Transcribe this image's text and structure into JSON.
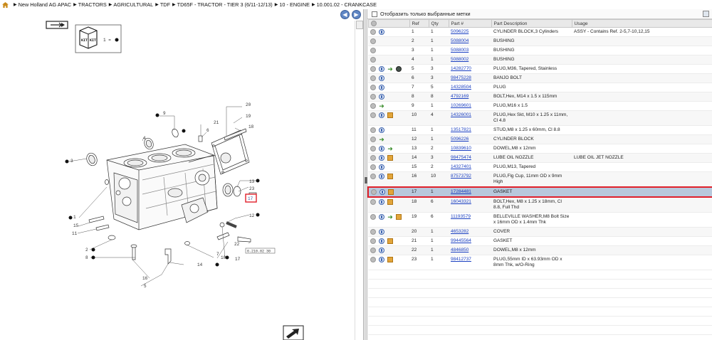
{
  "breadcrumb": {
    "items": [
      "New Holland AG APAC",
      "TRACTORS",
      "AGRICULTURAL",
      "TDF",
      "TD65F - TRACTOR - TIER 3 (6/11-12/13)",
      "10 - ENGINE",
      "10.001.02 - CRANKCASE"
    ]
  },
  "diagram": {
    "kit_marker": "1 =",
    "callouts": {
      "c1": "1",
      "c2": "2",
      "c3": "3",
      "c4": "4",
      "c5": "5",
      "c6": "6",
      "c7": "7",
      "c8": "8",
      "c9": "9",
      "c10": "10",
      "c11": "11",
      "c12": "12",
      "c13": "13",
      "c14": "14",
      "c15": "15",
      "c16": "16",
      "c17": "17",
      "c18": "18",
      "c19": "19",
      "c20": "20",
      "c21": "21",
      "c22": "22",
      "c23": "23"
    },
    "ref_code": "6.210.02  30"
  },
  "filter": {
    "label": "Отобразить только выбранные метки"
  },
  "table": {
    "headers": {
      "ref": "Ref",
      "qty": "Qty",
      "part": "Part #",
      "desc": "Part Description",
      "usage": "Usage"
    },
    "rows": [
      {
        "ref": "1",
        "qty": "1",
        "part": "5096225",
        "desc": "CYLINDER BLOCK,3 Cylinders",
        "usage": "ASSY - Contains Ref. 2-5,7-10,12,15",
        "icons": [
          "c",
          "i"
        ]
      },
      {
        "ref": "2",
        "qty": "1",
        "part": "5088004",
        "desc": "BUSHING",
        "usage": "",
        "icons": [
          "c"
        ]
      },
      {
        "ref": "3",
        "qty": "1",
        "part": "5088003",
        "desc": "BUSHING",
        "usage": "",
        "icons": [
          "c"
        ]
      },
      {
        "ref": "4",
        "qty": "1",
        "part": "5088002",
        "desc": "BUSHING",
        "usage": "",
        "icons": [
          "c"
        ]
      },
      {
        "ref": "5",
        "qty": "3",
        "part": "14282770",
        "desc": "PLUG,M36, Tapered, Stainless",
        "usage": "",
        "icons": [
          "c",
          "i",
          "a",
          "g"
        ]
      },
      {
        "ref": "6",
        "qty": "3",
        "part": "98475228",
        "desc": "BANJO BOLT",
        "usage": "",
        "icons": [
          "c",
          "i"
        ]
      },
      {
        "ref": "7",
        "qty": "5",
        "part": "14328504",
        "desc": "PLUG",
        "usage": "",
        "icons": [
          "c",
          "i"
        ]
      },
      {
        "ref": "8",
        "qty": "8",
        "part": "4792169",
        "desc": "BOLT,Hex, M14 x 1.5 x 115mm",
        "usage": "",
        "icons": [
          "c",
          "i"
        ]
      },
      {
        "ref": "9",
        "qty": "1",
        "part": "10269601",
        "desc": "PLUG,M16 x 1.5",
        "usage": "",
        "icons": [
          "c",
          "a"
        ]
      },
      {
        "ref": "10",
        "qty": "4",
        "part": "14326001",
        "desc": "PLUG,Hex Skt, M10 x 1.25 x 11mm, Cl 4.8",
        "usage": "",
        "icons": [
          "c",
          "i",
          "b"
        ]
      },
      {
        "ref": "11",
        "qty": "1",
        "part": "13517821",
        "desc": "STUD,M8 x 1.25 x 60mm, Cl 8.8",
        "usage": "",
        "icons": [
          "c",
          "i"
        ]
      },
      {
        "ref": "12",
        "qty": "1",
        "part": "5096226",
        "desc": "CYLINDER BLOCK",
        "usage": "",
        "icons": [
          "c",
          "a"
        ]
      },
      {
        "ref": "13",
        "qty": "2",
        "part": "10839610",
        "desc": "DOWEL,M8 x 12mm",
        "usage": "",
        "icons": [
          "c",
          "i",
          "a"
        ]
      },
      {
        "ref": "14",
        "qty": "3",
        "part": "98475474",
        "desc": "LUBE OIL NOZZLE",
        "usage": "LUBE OIL JET NOZZLE",
        "icons": [
          "c",
          "i",
          "b"
        ]
      },
      {
        "ref": "15",
        "qty": "2",
        "part": "14327401",
        "desc": "PLUG,M13, Tapered",
        "usage": "",
        "icons": [
          "c",
          "i"
        ]
      },
      {
        "ref": "16",
        "qty": "10",
        "part": "87573792",
        "desc": "PLUG,Flg Cup, 11mm OD x 9mm High",
        "usage": "",
        "icons": [
          "c",
          "i",
          "b"
        ]
      },
      {
        "ref": "17",
        "qty": "1",
        "part": "17284481",
        "desc": "GASKET",
        "usage": "",
        "icons": [
          "c",
          "i",
          "b"
        ],
        "selected": true
      },
      {
        "ref": "18",
        "qty": "6",
        "part": "16043321",
        "desc": "BOLT,Hex, M8 x 1.25 x 18mm, Cl 8.8, Full Thd",
        "usage": "",
        "icons": [
          "c",
          "i",
          "b"
        ]
      },
      {
        "ref": "19",
        "qty": "6",
        "part": "11193579",
        "desc": "BELLEVILLE WASHER,M8 Bolt Size x 16mm OD x 1.4mm Thk",
        "usage": "",
        "icons": [
          "c",
          "i",
          "a",
          "b"
        ]
      },
      {
        "ref": "20",
        "qty": "1",
        "part": "4653282",
        "desc": "COVER",
        "usage": "",
        "icons": [
          "c",
          "i"
        ]
      },
      {
        "ref": "21",
        "qty": "1",
        "part": "99445564",
        "desc": "GASKET",
        "usage": "",
        "icons": [
          "c",
          "i",
          "b"
        ]
      },
      {
        "ref": "22",
        "qty": "1",
        "part": "4846850",
        "desc": "DOWEL,M8 x 12mm",
        "usage": "",
        "icons": [
          "c",
          "i"
        ]
      },
      {
        "ref": "23",
        "qty": "1",
        "part": "98412737",
        "desc": "PLUG,55mm ID x 63.93mm OD x 8mm Thk, w/O-Ring",
        "usage": "",
        "icons": [
          "c",
          "i",
          "b"
        ]
      }
    ]
  },
  "colors": {
    "selection_border": "#e0202a",
    "selection_fill": "#b8c8dc",
    "link": "#1a3fc1",
    "nav": "#5f86c4"
  }
}
